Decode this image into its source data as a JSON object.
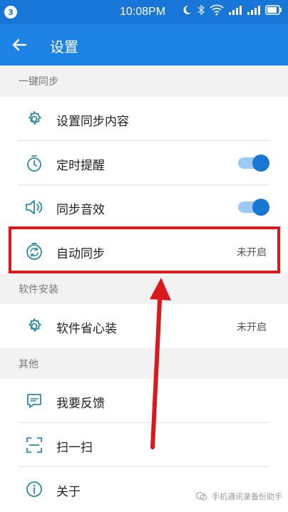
{
  "status_bar": {
    "notification_count": "3",
    "time": "10:08PM"
  },
  "app_bar": {
    "title": "设置"
  },
  "sections": [
    {
      "header": "一键同步",
      "items": [
        {
          "label": "设置同步内容"
        },
        {
          "label": "定时提醒",
          "toggle_on": true
        },
        {
          "label": "同步音效",
          "toggle_on": true
        },
        {
          "label": "自动同步",
          "value": "未开启"
        }
      ]
    },
    {
      "header": "软件安装",
      "items": [
        {
          "label": "软件省心装",
          "value": "未开启"
        }
      ]
    },
    {
      "header": "其他",
      "items": [
        {
          "label": "我要反馈"
        },
        {
          "label": "扫一扫"
        },
        {
          "label": "关于"
        }
      ]
    }
  ],
  "watermark": "手机通讯录备份助手",
  "colors": {
    "status_bar": "#1877d6",
    "app_bar": "#1c82e4",
    "icon": "#2e8ba5",
    "toggle_knob": "#1976d2",
    "highlight": "#d9191c"
  }
}
